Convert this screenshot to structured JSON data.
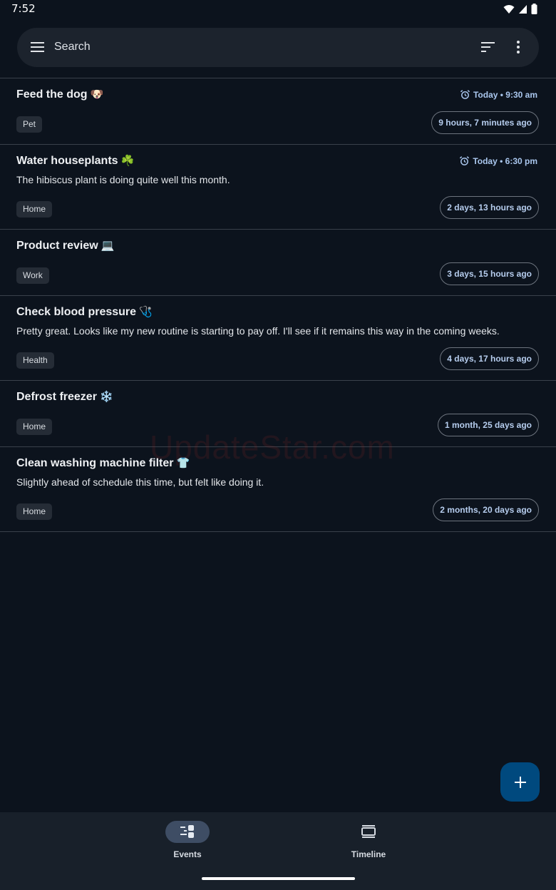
{
  "status_bar": {
    "time": "7:52"
  },
  "search": {
    "placeholder": "Search"
  },
  "events": [
    {
      "title": "Feed the dog",
      "emoji": "🐶",
      "note": "",
      "tag": "Pet",
      "alarm": "Today • 9:30 am",
      "elapsed": "9 hours, 7 minutes ago"
    },
    {
      "title": "Water houseplants",
      "emoji": "☘️",
      "note": "The hibiscus plant is doing quite well this month.",
      "tag": "Home",
      "alarm": "Today • 6:30 pm",
      "elapsed": "2 days, 13 hours ago"
    },
    {
      "title": "Product review",
      "emoji": "💻",
      "note": "",
      "tag": "Work",
      "alarm": "",
      "elapsed": "3 days, 15 hours ago"
    },
    {
      "title": "Check blood pressure",
      "emoji": "🩺",
      "note": "Pretty great. Looks like my new routine is starting to pay off. I'll see if it remains this way in the coming weeks.",
      "tag": "Health",
      "alarm": "",
      "elapsed": "4 days, 17 hours ago"
    },
    {
      "title": "Defrost freezer",
      "emoji": "❄️",
      "note": "",
      "tag": "Home",
      "alarm": "",
      "elapsed": "1 month, 25 days ago"
    },
    {
      "title": "Clean washing machine filter",
      "emoji": "👕",
      "note": "Slightly ahead of schedule this time, but felt like doing it.",
      "tag": "Home",
      "alarm": "",
      "elapsed": "2 months, 20 days ago"
    }
  ],
  "watermark": "UpdateStar.com",
  "bottom_nav": {
    "tabs": [
      {
        "label": "Events",
        "icon": "events-icon",
        "active": true
      },
      {
        "label": "Timeline",
        "icon": "timeline-icon",
        "active": false
      }
    ]
  },
  "colors": {
    "background": "#0c131d",
    "surface": "#1c232d",
    "accent": "#aac7ee",
    "fab": "#00497e",
    "nav_indicator": "#3e4d64"
  }
}
